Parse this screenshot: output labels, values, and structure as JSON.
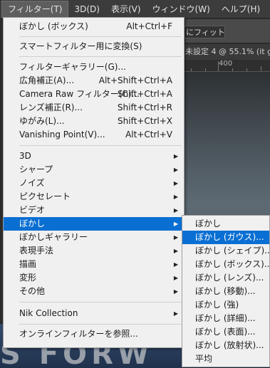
{
  "menubar": {
    "items": [
      {
        "label": "フィルター(T)"
      },
      {
        "label": "3D(D)"
      },
      {
        "label": "表示(V)"
      },
      {
        "label": "ウィンドウ(W)"
      },
      {
        "label": "ヘルプ(H)"
      }
    ]
  },
  "background": {
    "fit_button": "にフィット",
    "doc_tab": "未設定 4 @ 55.1% (it g",
    "ruler_label": "400",
    "canvas_text": "S   FORW"
  },
  "filter_menu": {
    "items": [
      {
        "label": "ぼかし (ボックス)",
        "shortcut": "Alt+Ctrl+F"
      },
      {
        "label": "スマートフィルター用に変換(S)",
        "shortcut": ""
      },
      {
        "label": "フィルターギャラリー(G)...",
        "shortcut": ""
      },
      {
        "label": "広角補正(A)...",
        "shortcut": "Alt+Shift+Ctrl+A"
      },
      {
        "label": "Camera Raw フィルター(C)...",
        "shortcut": "Shift+Ctrl+A"
      },
      {
        "label": "レンズ補正(R)...",
        "shortcut": "Shift+Ctrl+R"
      },
      {
        "label": "ゆがみ(L)...",
        "shortcut": "Shift+Ctrl+X"
      },
      {
        "label": "Vanishing Point(V)...",
        "shortcut": "Alt+Ctrl+V"
      },
      {
        "label": "3D",
        "shortcut": ""
      },
      {
        "label": "シャープ",
        "shortcut": ""
      },
      {
        "label": "ノイズ",
        "shortcut": ""
      },
      {
        "label": "ピクセレート",
        "shortcut": ""
      },
      {
        "label": "ビデオ",
        "shortcut": ""
      },
      {
        "label": "ぼかし",
        "shortcut": ""
      },
      {
        "label": "ぼかしギャラリー",
        "shortcut": ""
      },
      {
        "label": "表現手法",
        "shortcut": ""
      },
      {
        "label": "描画",
        "shortcut": ""
      },
      {
        "label": "変形",
        "shortcut": ""
      },
      {
        "label": "その他",
        "shortcut": ""
      },
      {
        "label": "Nik Collection",
        "shortcut": ""
      },
      {
        "label": "オンラインフィルターを参照...",
        "shortcut": ""
      }
    ]
  },
  "blur_submenu": {
    "items": [
      {
        "label": "ぼかし"
      },
      {
        "label": "ぼかし (ガウス)..."
      },
      {
        "label": "ぼかし (シェイプ)..."
      },
      {
        "label": "ぼかし (ボックス)..."
      },
      {
        "label": "ぼかし (レンズ)..."
      },
      {
        "label": "ぼかし (移動)..."
      },
      {
        "label": "ぼかし (強)"
      },
      {
        "label": "ぼかし (詳細)..."
      },
      {
        "label": "ぼかし (表面)..."
      },
      {
        "label": "ぼかし (放射状)..."
      },
      {
        "label": "平均"
      }
    ]
  },
  "colors": {
    "highlight": "#0a6fd3",
    "menu_bg": "#f0f0f0",
    "menubar_bg": "#3c3c3c"
  }
}
